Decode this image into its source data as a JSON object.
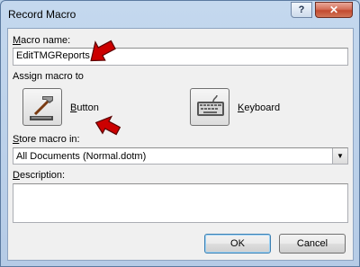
{
  "window": {
    "title": "Record Macro"
  },
  "titlebar": {
    "help": "?",
    "close": "✕"
  },
  "macro_name": {
    "label_key": "M",
    "label_rest": "acro name:",
    "value": "EditTMGReports"
  },
  "assign": {
    "heading": "Assign macro to",
    "button_key": "B",
    "button_rest": "utton",
    "keyboard_key": "K",
    "keyboard_rest": "eyboard"
  },
  "store": {
    "label_key": "S",
    "label_rest": "tore macro in:",
    "value": "All Documents (Normal.dotm)"
  },
  "description": {
    "label_key": "D",
    "label_rest": "escription:",
    "value": ""
  },
  "buttons": {
    "ok": "OK",
    "cancel": "Cancel"
  },
  "colors": {
    "arrow": "#cc0000",
    "accent": "#3c7fb1"
  }
}
